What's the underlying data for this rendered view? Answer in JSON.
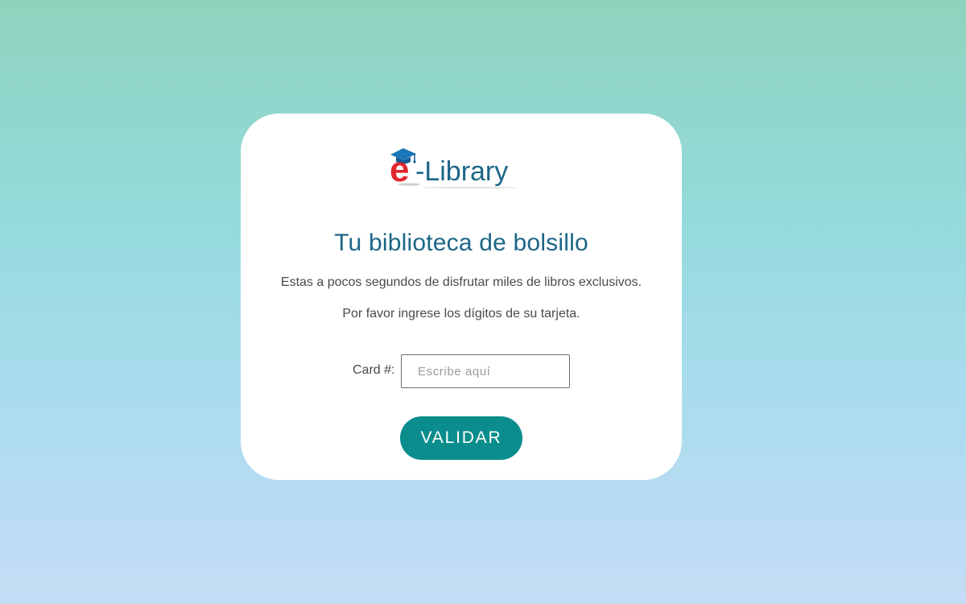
{
  "logo": {
    "prefix": "e",
    "text": "-Library",
    "icon": "graduation-cap-icon",
    "colors": {
      "e": "#e0262d",
      "text": "#1c6687",
      "cap": "#1a76b8"
    }
  },
  "content": {
    "title": "Tu biblioteca de bolsillo",
    "subtitle": "Estas a pocos segundos de disfrutar miles de libros exclusivos.",
    "instruction": "Por favor ingrese los dígitos de su tarjeta."
  },
  "form": {
    "card_label": "Card #:",
    "card_placeholder": "Escribe aquí",
    "card_value": "",
    "submit_label": "VALIDAR"
  },
  "colors": {
    "accent": "#0a8d8c",
    "title": "#1c6687",
    "background_top": "#8fd3bd",
    "background_bottom": "#c5dcf5"
  }
}
